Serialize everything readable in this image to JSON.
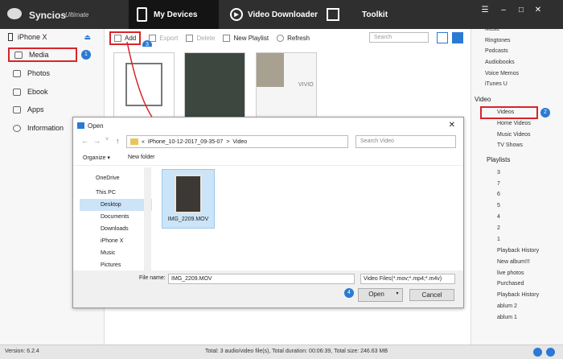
{
  "app": {
    "name": "Syncios",
    "edition": "Ultimate"
  },
  "tabs": [
    {
      "label": "My Devices"
    },
    {
      "label": "Video Downloader"
    },
    {
      "label": "Toolkit"
    }
  ],
  "window_buttons": [
    "☰",
    "–",
    "□",
    "✕"
  ],
  "device": {
    "name": "iPhone X"
  },
  "left_nav": [
    "Media",
    "Photos",
    "Ebook",
    "Apps",
    "Information"
  ],
  "toolbar": {
    "add": "Add",
    "export": "Export",
    "delete": "Delete",
    "new_playlist": "New Playlist",
    "refresh": "Refresh",
    "search_placeholder": "Search"
  },
  "thumb_caption": "VIVIO",
  "right_panel": {
    "top_items": [
      "Music",
      "Ringtones",
      "Podcasts",
      "Audiobooks",
      "Voice Memos",
      "iTunes U"
    ],
    "video_header": "Video",
    "video_items": [
      "Videos",
      "Home Videos",
      "Music Videos",
      "TV Shows"
    ],
    "playlists_header": "Playlists",
    "playlists": [
      "3",
      "7",
      "6",
      "5",
      "4",
      "2",
      "1",
      "Playback History",
      "New album!!!",
      "live photos",
      "Purchased",
      "Playback History",
      "ablum 2",
      "ablum 1"
    ]
  },
  "badges": [
    "1",
    "2",
    "3",
    "4"
  ],
  "dialog": {
    "title": "Open",
    "path": [
      "«",
      "iPhone_10-12-2017_09-35-07",
      ">",
      "Video"
    ],
    "search_placeholder": "Search Video",
    "organize": "Organize ▾",
    "new_folder": "New folder",
    "tree": [
      "OneDrive",
      "This PC",
      "Desktop",
      "Documents",
      "Downloads",
      "iPhone X",
      "Music",
      "Pictures"
    ],
    "file_name": "IMG_2209.MOV",
    "file_name_label": "File name:",
    "file_name_value": "IMG_2209.MOV",
    "file_type": "Video Files(*.mov;*.mp4;*.m4v)",
    "open": "Open",
    "cancel": "Cancel"
  },
  "status": {
    "version": "Version: 6.2.4",
    "summary": "Total: 3 audio/video file(s), Total duration: 00:06:39, Total size: 246.63 MB"
  },
  "colors": {
    "accent": "#2a7ad3",
    "highlight": "#d7242b",
    "topbar": "#2f2f2f"
  }
}
